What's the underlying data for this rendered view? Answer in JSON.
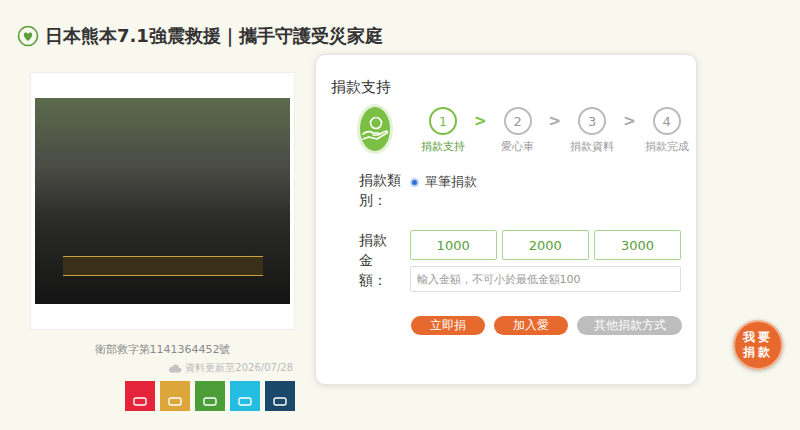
{
  "page": {
    "title": "日本熊本7.1強震救援｜攜手守護受災家庭"
  },
  "banner": {
    "license": "衛部救字第1141364452號",
    "updated": "資料更新至2026/07/28"
  },
  "sdgs": [
    {
      "color": "#e5243b"
    },
    {
      "color": "#dda63a"
    },
    {
      "color": "#4c9f38"
    },
    {
      "color": "#26bde2"
    },
    {
      "color": "#19486a"
    }
  ],
  "donation": {
    "title": "捐款支持",
    "steps": [
      {
        "number": "1",
        "label": "捐款支持",
        "selected": true
      },
      {
        "number": "2",
        "label": "愛心車",
        "selected": false
      },
      {
        "number": "3",
        "label": "捐款資料",
        "selected": false
      },
      {
        "number": "4",
        "label": "捐款完成",
        "selected": false
      }
    ],
    "step_separator": ">",
    "type_label": "捐款類別：",
    "types": [
      {
        "label": "單筆捐款",
        "selected": true
      }
    ],
    "amount_label": "捐款金額：",
    "amounts": [
      "1000",
      "2000",
      "3000"
    ],
    "amount_placeholder": "輸入金額，不可小於最低金額100",
    "actions": [
      {
        "label": "立即捐",
        "kind": "primary"
      },
      {
        "label": "加入愛",
        "kind": "primary"
      },
      {
        "label": "其他捐款方式",
        "kind": "secondary"
      }
    ]
  },
  "float_button": "我要捐款"
}
